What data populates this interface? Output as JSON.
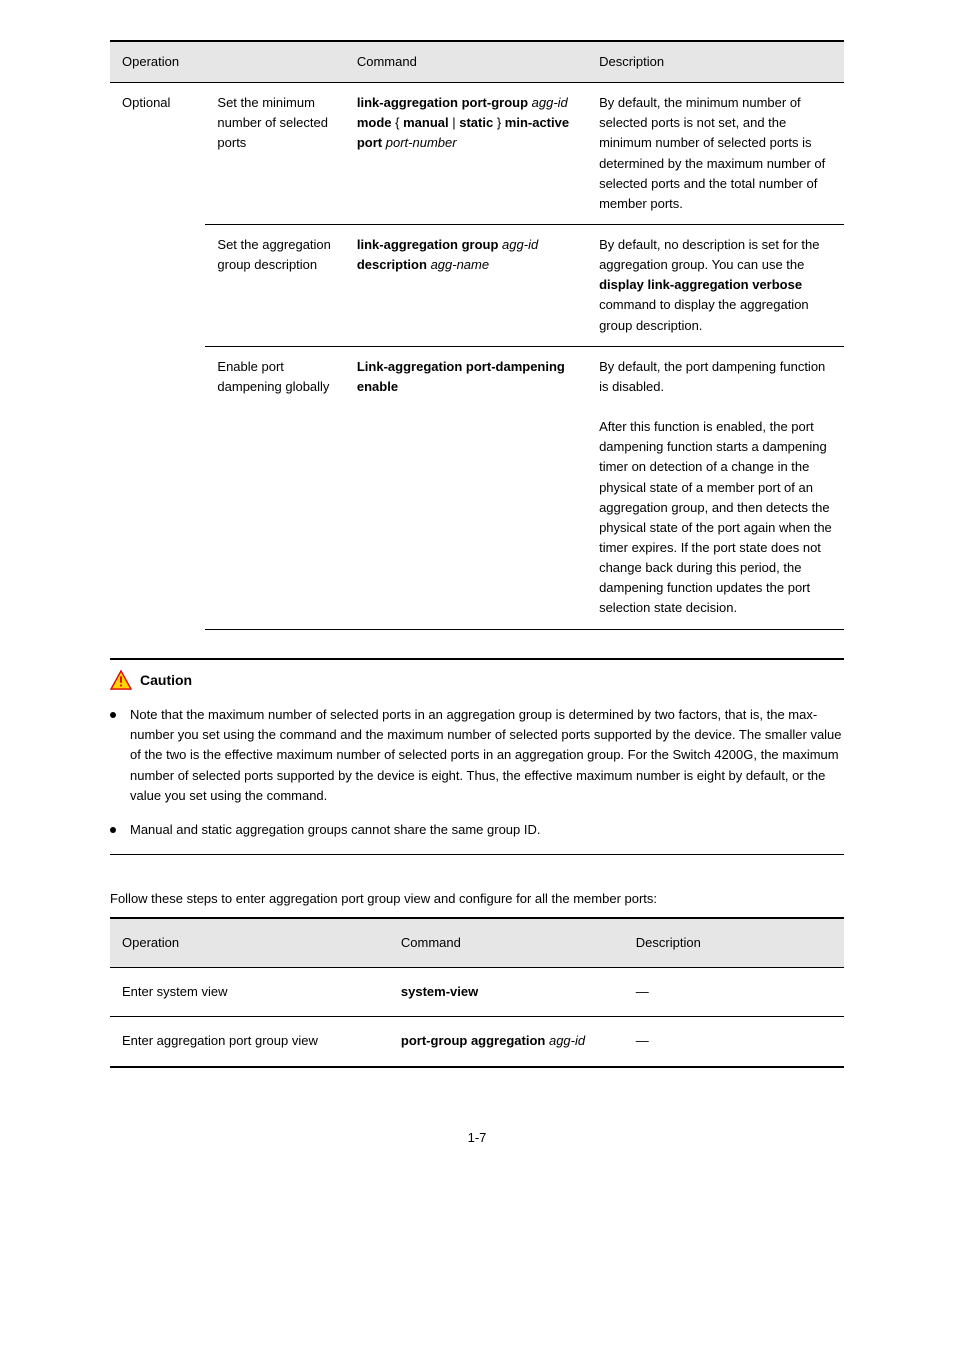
{
  "t1": {
    "head": [
      "Operation",
      "Command",
      "Description"
    ],
    "group_label": "Optional",
    "rows": [
      {
        "op_html": "Set the minimum number of selected ports",
        "cmd_html": "<span class=\"bold\">link-aggregation port-group</span> <span class=\"ital\">agg-id</span> <span class=\"bold\">mode</span> { <span class=\"bold\">manual</span> | <span class=\"bold\">static</span> } <span class=\"bold\">min-active port</span> <span class=\"ital\">port-number</span>",
        "desc_html": "By default, the minimum number of selected ports is not set, and the minimum number of selected ports is determined by the maximum number of selected ports and the total number of member ports."
      },
      {
        "op_html": "Set the aggregation group description",
        "cmd_html": "<span class=\"bold\">link-aggregation group</span> <span class=\"ital\">agg-id</span> <span class=\"bold\">description</span> <span class=\"ital\">agg-name</span>",
        "desc_html": "By default, no description is set for the aggregation group. You can use the <span class=\"bold\">display link-aggregation verbose</span> command to display the aggregation group description."
      },
      {
        "op_html": "Enable port dampening globally",
        "cmd_html": "<span class=\"bold\">Link-aggregation port-dampening enable</span>",
        "desc_html": "By default, the port dampening function is disabled.<br><br>After this function is enabled, the port dampening function starts a dampening timer on detection of a change in the physical state of a member port of an aggregation group, and then detects the physical state of the port again when the timer expires. If the port state does not change back during this period, the dampening function updates the port selection state decision."
      }
    ]
  },
  "caution": {
    "label": "Caution",
    "bullets": [
      "Note that the maximum number of selected ports in an aggregation group is determined by two factors, that is, the max-number you set using the command and the maximum number of selected ports supported by the device. The smaller value of the two is the effective maximum number of selected ports in an aggregation group. For the Switch 4200G, the maximum number of selected ports supported by the device is eight. Thus, the effective maximum number is eight by default, or the value you set using the command.",
      "Manual and static aggregation groups cannot share the same group ID."
    ]
  },
  "t2": {
    "caption_html": "Follow these steps to enter aggregation port group view and configure for all the member ports:",
    "head": [
      "Operation",
      "Command",
      "Description"
    ],
    "rows": [
      {
        "op": "Enter system view",
        "cmd_html": "<span class=\"bold\">system-view</span>",
        "desc": "—"
      },
      {
        "op": "Enter aggregation port group view",
        "cmd_html": "<span class=\"bold\">port-group aggregation</span> <span class=\"ital\">agg-id</span>",
        "desc": "—"
      }
    ]
  },
  "page_number": "1-7"
}
